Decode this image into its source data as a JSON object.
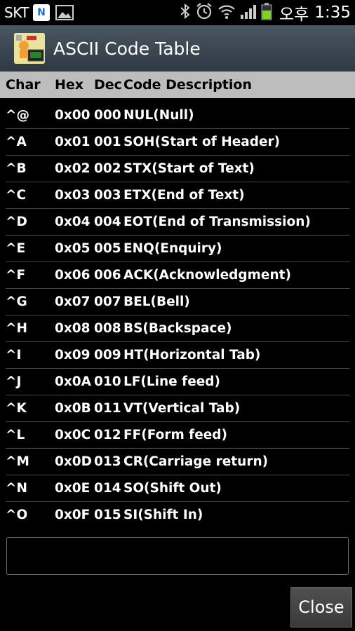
{
  "status_bar": {
    "carrier": "SKT",
    "notification_icon_label": "N",
    "clock_ampm": "오후",
    "clock_time": "1:35"
  },
  "app": {
    "title": "ASCII Code Table"
  },
  "table": {
    "headers": [
      "Char",
      "Hex",
      "Dec",
      "Code Description"
    ],
    "rows": [
      [
        "^@",
        "0x00",
        "000",
        "NUL(Null)"
      ],
      [
        "^A",
        "0x01",
        "001",
        "SOH(Start of Header)"
      ],
      [
        "^B",
        "0x02",
        "002",
        "STX(Start of Text)"
      ],
      [
        "^C",
        "0x03",
        "003",
        "ETX(End of Text)"
      ],
      [
        "^D",
        "0x04",
        "004",
        "EOT(End of Transmission)"
      ],
      [
        "^E",
        "0x05",
        "005",
        "ENQ(Enquiry)"
      ],
      [
        "^F",
        "0x06",
        "006",
        "ACK(Acknowledgment)"
      ],
      [
        "^G",
        "0x07",
        "007",
        "BEL(Bell)"
      ],
      [
        "^H",
        "0x08",
        "008",
        "BS(Backspace)"
      ],
      [
        "^I",
        "0x09",
        "009",
        "HT(Horizontal Tab)"
      ],
      [
        "^J",
        "0x0A",
        "010",
        "LF(Line feed)"
      ],
      [
        "^K",
        "0x0B",
        "011",
        "VT(Vertical Tab)"
      ],
      [
        "^L",
        "0x0C",
        "012",
        "FF(Form feed)"
      ],
      [
        "^M",
        "0x0D",
        "013",
        "CR(Carriage return)"
      ],
      [
        "^N",
        "0x0E",
        "014",
        "SO(Shift Out)"
      ],
      [
        "^O",
        "0x0F",
        "015",
        "SI(Shift In)"
      ]
    ]
  },
  "input": {
    "value": "",
    "placeholder": ""
  },
  "buttons": {
    "close_label": "Close"
  }
}
